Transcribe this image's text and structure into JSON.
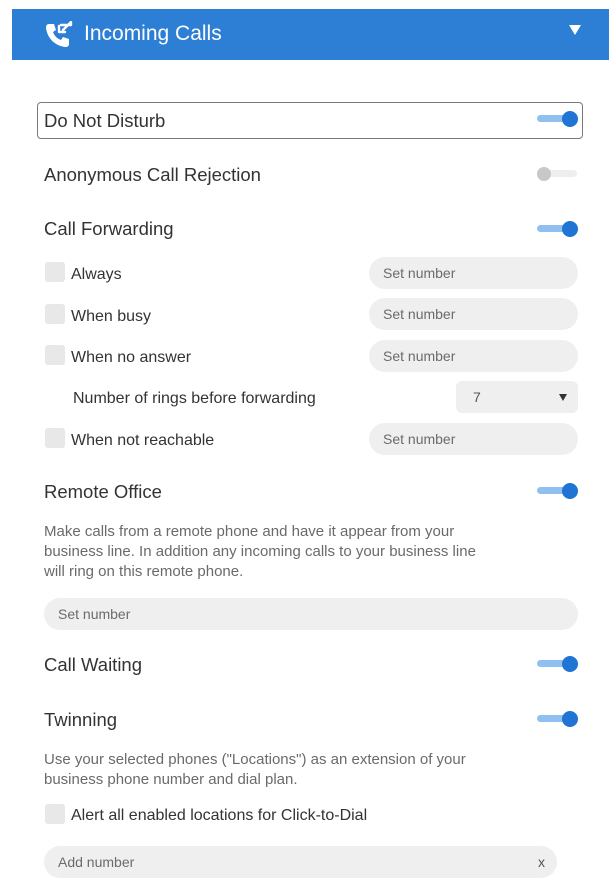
{
  "header": {
    "title": "Incoming Calls"
  },
  "dnd": {
    "label": "Do Not Disturb",
    "on": true
  },
  "anon": {
    "label": "Anonymous Call Rejection",
    "on": false
  },
  "forwarding": {
    "label": "Call Forwarding",
    "on": true,
    "always": {
      "label": "Always",
      "placeholder": "Set number"
    },
    "busy": {
      "label": "When busy",
      "placeholder": "Set number"
    },
    "no_answer": {
      "label": "When no answer",
      "placeholder": "Set number"
    },
    "rings": {
      "label": "Number of rings before forwarding",
      "value": "7"
    },
    "not_reachable": {
      "label": "When not reachable",
      "placeholder": "Set number"
    }
  },
  "remote_office": {
    "label": "Remote Office",
    "on": true,
    "desc_lines": [
      "Make calls from a remote phone and have it appear from your",
      "business line. In addition any incoming calls to your business line",
      "will ring on this remote phone."
    ],
    "placeholder": "Set number"
  },
  "call_waiting": {
    "label": "Call Waiting",
    "on": true
  },
  "twinning": {
    "label": "Twinning",
    "on": true,
    "desc_lines": [
      "Use your selected phones (\"Locations\") as an extension of your",
      "business phone number and dial plan."
    ],
    "alert_label": "Alert all enabled locations for Click-to-Dial",
    "add_placeholder": "Add number",
    "clear_label": "x"
  },
  "icons": [
    "phone-incoming-icon",
    "chevron-down-icon"
  ],
  "colors": {
    "header": "#2d7fd6",
    "toggle_on": "#1f74d4",
    "toggle_track": "#8fc0ef"
  }
}
